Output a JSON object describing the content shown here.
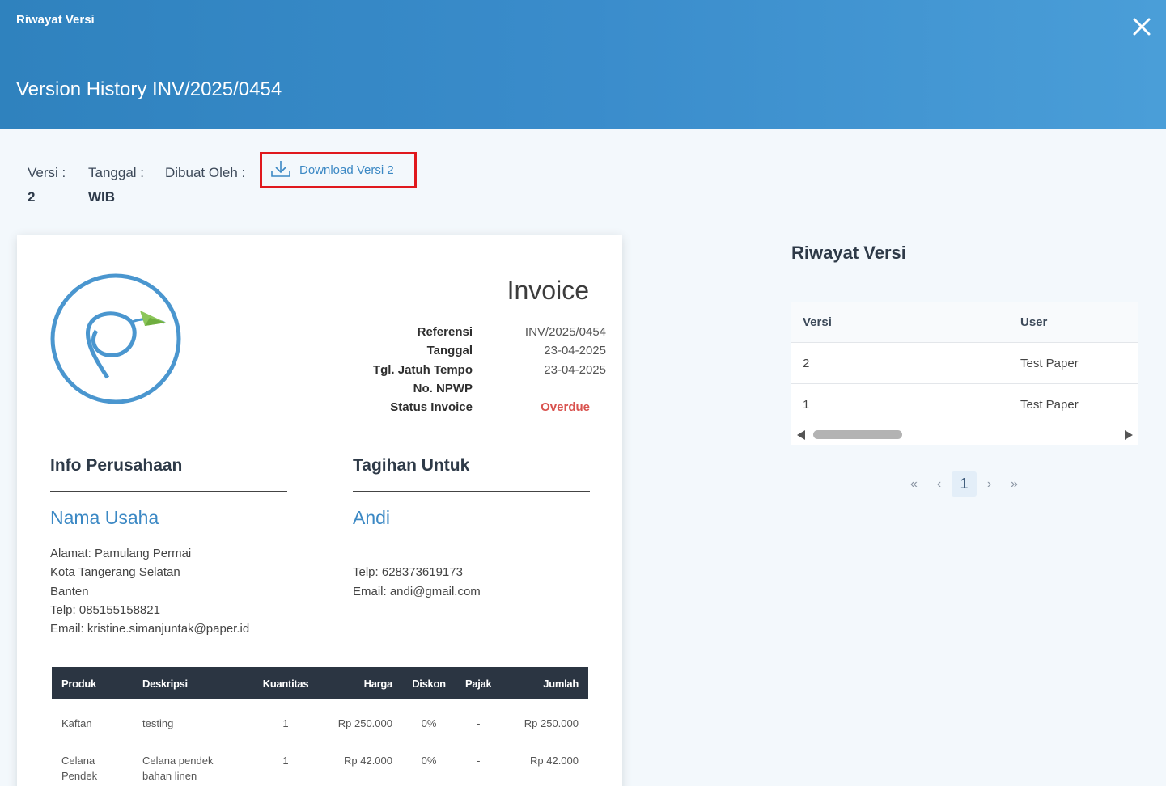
{
  "header": {
    "small_title": "Riwayat Versi",
    "title": "Version History INV/2025/0454"
  },
  "meta": {
    "versi_label": "Versi :",
    "versi_value": "2",
    "tanggal_label": "Tanggal :",
    "tanggal_value": "WIB",
    "dibuat_label": "Dibuat Oleh :",
    "download_label": "Download Versi 2"
  },
  "invoice": {
    "title": "Invoice",
    "labels": [
      "Referensi",
      "Tanggal",
      "Tgl. Jatuh Tempo",
      "No. NPWP",
      "Status Invoice"
    ],
    "referensi": "INV/2025/0454",
    "tanggal": "23-04-2025",
    "jatuh_tempo": "23-04-2025",
    "npwp": "",
    "status": "Overdue",
    "company": {
      "heading": "Info Perusahaan",
      "name": "Nama Usaha",
      "lines": [
        "Alamat: Pamulang Permai",
        "Kota Tangerang Selatan",
        "Banten",
        "Telp: 085155158821",
        "Email: kristine.simanjuntak@paper.id"
      ]
    },
    "bill_to": {
      "heading": "Tagihan Untuk",
      "name": "Andi",
      "lines": [
        "",
        "Telp: 628373619173",
        "Email: andi@gmail.com"
      ]
    },
    "columns": [
      "Produk",
      "Deskripsi",
      "Kuantitas",
      "Harga",
      "Diskon",
      "Pajak",
      "Jumlah"
    ],
    "items": [
      {
        "produk": "Kaftan",
        "deskripsi": "testing",
        "qty": "1",
        "harga": "Rp 250.000",
        "diskon": "0%",
        "pajak": "-",
        "jumlah": "Rp 250.000"
      },
      {
        "produk": "Celana Pendek",
        "deskripsi": "Celana pendek bahan linen",
        "qty": "1",
        "harga": "Rp 42.000",
        "diskon": "0%",
        "pajak": "-",
        "jumlah": "Rp 42.000"
      }
    ]
  },
  "history": {
    "title": "Riwayat Versi",
    "col_versi": "Versi",
    "col_user": "User",
    "rows": [
      {
        "versi": "2",
        "user": "Test Paper"
      },
      {
        "versi": "1",
        "user": "Test Paper"
      }
    ]
  },
  "pager": {
    "first": "«",
    "prev": "‹",
    "current": "1",
    "next": "›",
    "last": "»"
  },
  "colors": {
    "header_blue": "#3a8ccb",
    "accent_blue": "#3b88c4",
    "highlight_red": "#e0191e",
    "overdue_red": "#d9534f",
    "table_header": "#2b3542"
  }
}
